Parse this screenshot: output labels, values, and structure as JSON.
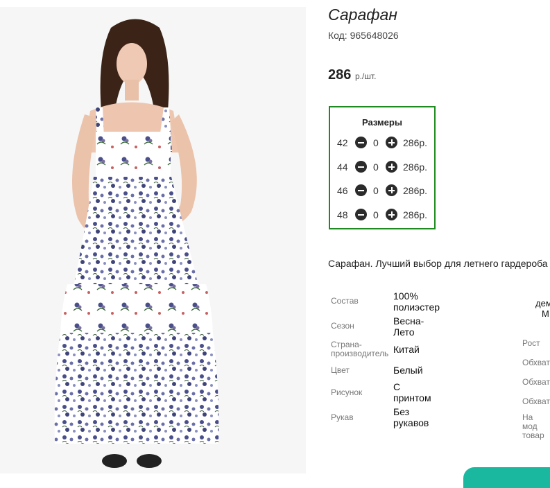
{
  "product": {
    "title": "Сарафан",
    "code_label": "Код:",
    "code_value": "965648026",
    "price_value": "286",
    "price_unit": "р./шт."
  },
  "sizes": {
    "title": "Размеры",
    "rows": [
      {
        "size": "42",
        "qty": "0",
        "price": "286р."
      },
      {
        "size": "44",
        "qty": "0",
        "price": "286р."
      },
      {
        "size": "46",
        "qty": "0",
        "price": "286р."
      },
      {
        "size": "48",
        "qty": "0",
        "price": "286р."
      }
    ]
  },
  "description": "Сарафан. Лучший выбор для летнего гардероба",
  "attributes": [
    {
      "label": "Состав",
      "value": "100% полиэстер"
    },
    {
      "label": "Сезон",
      "value": "Весна-Лето"
    },
    {
      "label": "Страна-производитель",
      "value": "Китай"
    },
    {
      "label": "Цвет",
      "value": "Белый"
    },
    {
      "label": "Рисунок",
      "value": "С принтом"
    },
    {
      "label": "Рукав",
      "value": "Без рукавов"
    }
  ],
  "right_column": {
    "labels": [
      "Рост",
      "Обхват",
      "Обхват",
      "Обхват",
      "На мод товар"
    ],
    "partial_value_1": "дем",
    "partial_value_2": "М"
  },
  "colors": {
    "sizes_border": "#1f8a1f",
    "accent_teal": "#1bb8a0",
    "dress_print": "#4a4f8a"
  },
  "icons": {
    "minus": "minus-circle-icon",
    "plus": "plus-circle-icon"
  }
}
